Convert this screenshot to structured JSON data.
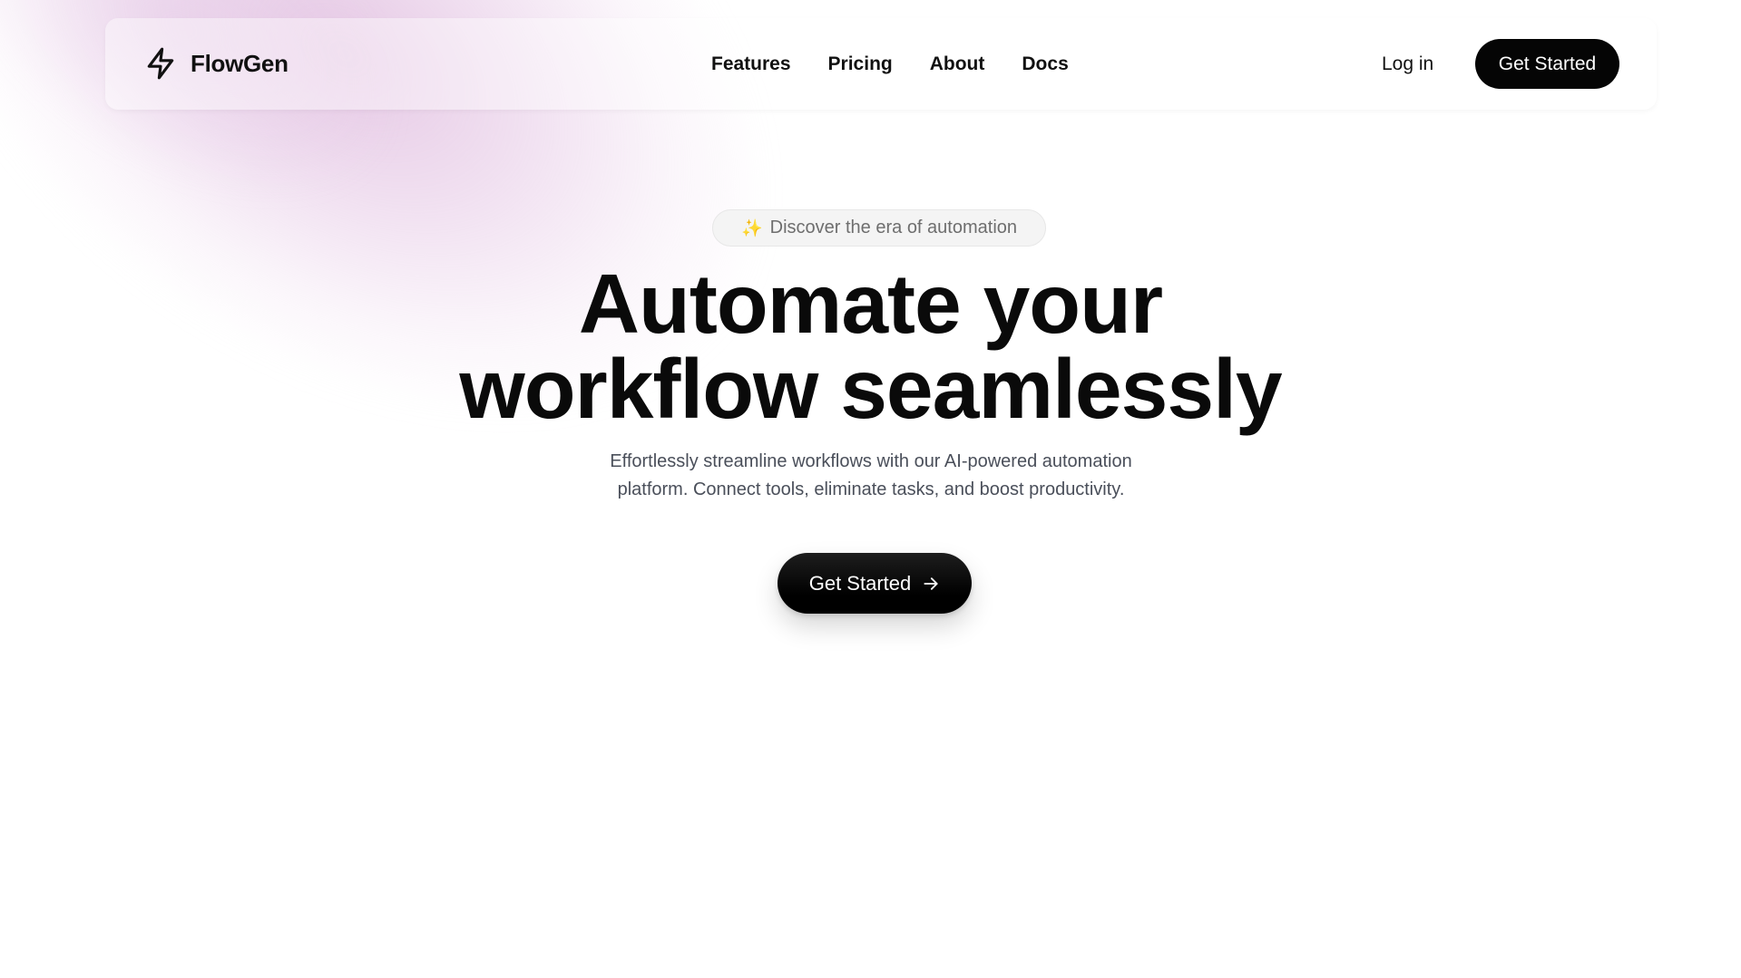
{
  "brand": {
    "name": "FlowGen",
    "icon": "lightning-bolt-icon"
  },
  "nav": {
    "links": [
      "Features",
      "Pricing",
      "About",
      "Docs"
    ],
    "login_label": "Log in",
    "cta_label": "Get Started"
  },
  "hero": {
    "badge_icon": "sparkles-icon",
    "badge_text": "Discover the era of automation",
    "headline_lines": [
      "Automate your",
      "workflow seamlessly"
    ],
    "subtext_lines": [
      "Effortlessly streamline workflows with our AI-powered automation",
      "platform. Connect tools, eliminate tasks, and boost productivity."
    ],
    "cta_label": "Get Started",
    "cta_icon": "arrow-right-icon"
  },
  "colors": {
    "primary": "#050505",
    "text": "#0a0a0a",
    "muted_text": "#4a4f5a",
    "badge_text": "#6e6e6e",
    "glow": "#d6a6d4",
    "background": "#ffffff"
  }
}
